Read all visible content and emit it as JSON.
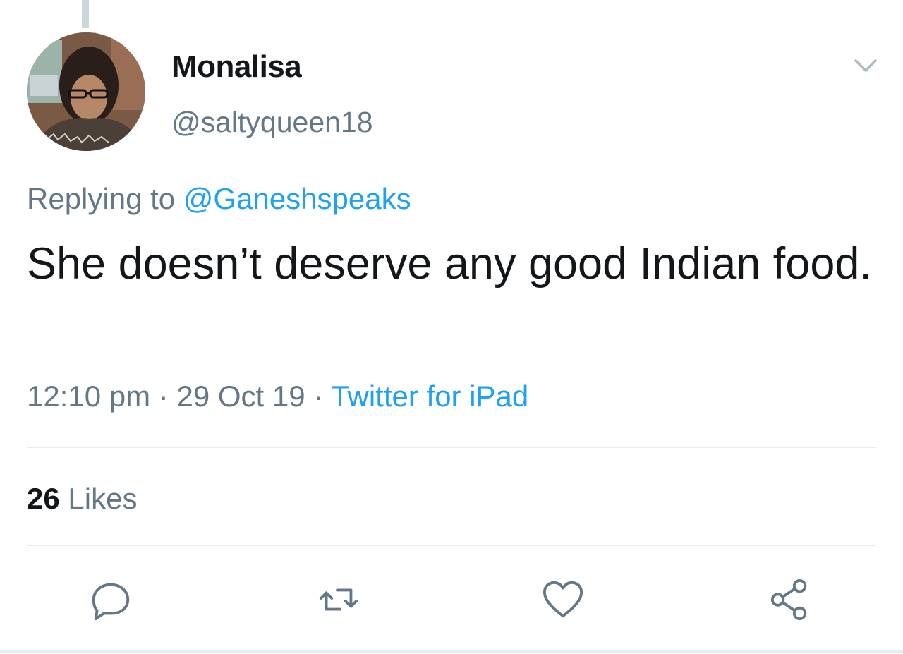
{
  "tweet": {
    "display_name": "Monalisa",
    "handle": "@saltyqueen18",
    "replying_prefix": "Replying to",
    "replying_to": "@Ganeshspeaks",
    "text": "She doesn’t deserve any good Indian food.",
    "time": "12:10 pm",
    "date": "29 Oct 19",
    "source": "Twitter for iPad",
    "separator": "·",
    "likes_count": "26",
    "likes_label": "Likes"
  },
  "icons": {
    "menu": "chevron-down-icon",
    "reply": "reply-icon",
    "retweet": "retweet-icon",
    "like": "heart-icon",
    "share": "share-icon"
  },
  "colors": {
    "primary_text": "#14171a",
    "secondary_text": "#657786",
    "link": "#1da1f2",
    "divider": "#e6ecf0"
  }
}
